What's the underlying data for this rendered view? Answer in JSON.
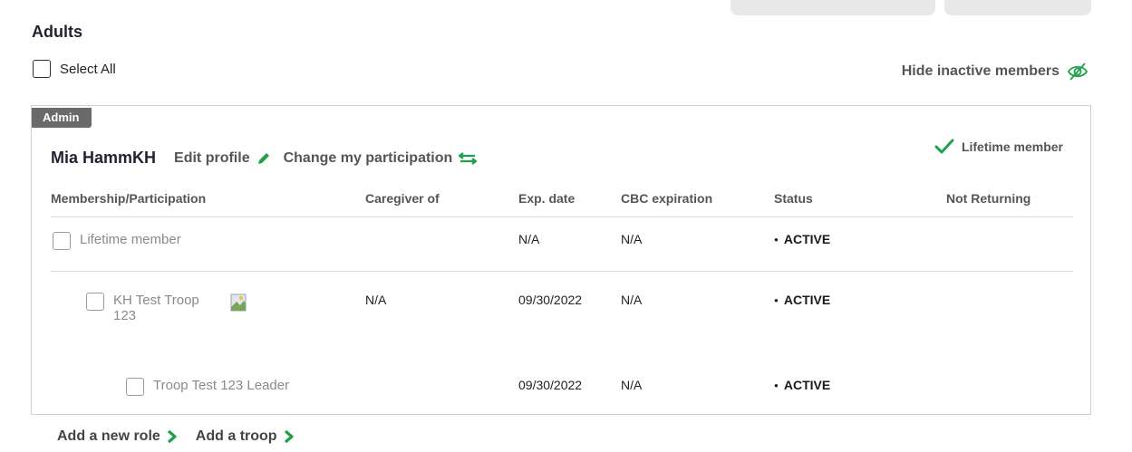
{
  "section": {
    "title": "Adults"
  },
  "select_all": {
    "label": "Select All"
  },
  "hide_inactive": {
    "label": "Hide inactive members",
    "icon": "eye-slash-icon"
  },
  "colors": {
    "accent": "#1ea14b",
    "badge": "#6a6a6a",
    "text_muted": "#555555"
  },
  "member": {
    "badge": "Admin",
    "name": "Mia HammKH",
    "edit_profile": "Edit profile",
    "change_participation": "Change my participation",
    "lifetime_label": "Lifetime member"
  },
  "table": {
    "headers": [
      "Membership/Participation",
      "Caregiver of",
      "Exp. date",
      "CBC expiration",
      "Status",
      "Not Returning"
    ],
    "rows": [
      {
        "membership": "Lifetime member",
        "caregiver": "",
        "exp": "N/A",
        "cbc": "N/A",
        "status": "ACTIVE",
        "not_returning": ""
      },
      {
        "membership": "KH Test Troop 123",
        "caregiver": "N/A",
        "exp": "09/30/2022",
        "cbc": "N/A",
        "status": "ACTIVE",
        "not_returning": ""
      },
      {
        "membership": "Troop Test 123 Leader",
        "caregiver": "",
        "exp": "09/30/2022",
        "cbc": "N/A",
        "status": "ACTIVE",
        "not_returning": ""
      }
    ]
  },
  "footer": {
    "add_role": "Add a new role",
    "add_troop": "Add a troop"
  }
}
